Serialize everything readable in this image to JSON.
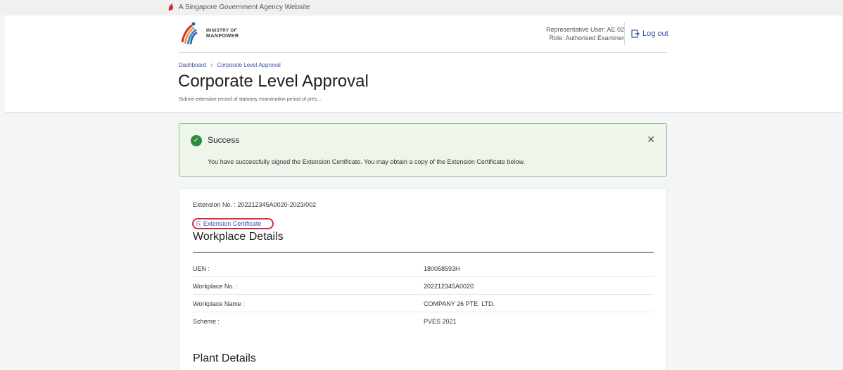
{
  "gov_banner": {
    "text": "A Singapore Government Agency Website"
  },
  "logo": {
    "line1": "MINISTRY OF",
    "line2": "MANPOWER"
  },
  "user": {
    "representative": "Representative User: AE 02",
    "role": "Role: Authorised Examiner"
  },
  "logout_label": "Log out",
  "breadcrumb": {
    "home": "Dashboard",
    "current": "Corporate Level Approval"
  },
  "page": {
    "title": "Corporate Level Approval",
    "subtitle": "Submit extension record of statutory examination period of pres..."
  },
  "alert": {
    "title": "Success",
    "message": "You have successfully signed the Extension Certificate. You may obtain a copy of the Extension Certificate below."
  },
  "extension": {
    "number": "Extension No. : 202212345A0020-2023/002",
    "certificate_link": "Extension Certificate"
  },
  "workplace": {
    "title": "Workplace Details",
    "rows": [
      {
        "label": "UEN :",
        "value": "180058593H"
      },
      {
        "label": "Workplace No. :",
        "value": "202212345A0020"
      },
      {
        "label": "Workplace Name :",
        "value": "COMPANY 26 PTE. LTD."
      },
      {
        "label": "Scheme :",
        "value": "PVES 2021"
      }
    ]
  },
  "plant": {
    "title": "Plant Details"
  },
  "colors": {
    "accent": "#3b4fa8",
    "success": "#2e8b3a",
    "highlight": "#d12b3c"
  }
}
